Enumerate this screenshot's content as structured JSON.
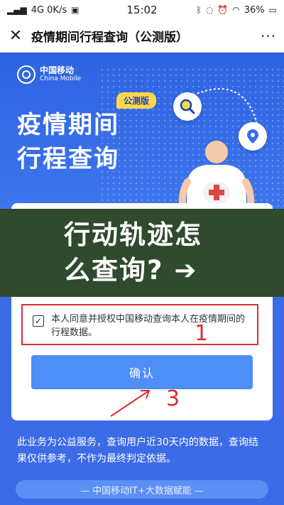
{
  "status_bar": {
    "left": "4G  0K/s",
    "signal": "all",
    "time": "15:02",
    "battery": "36%"
  },
  "nav": {
    "close_icon": "close-icon",
    "title": "疫情期间行程查询（公测版）",
    "more_icon": "more-dots-icon"
  },
  "banner": {
    "logo_cn": "中国移动",
    "logo_en": "China Mobile",
    "badge": "公测版",
    "headline_line1": "疫情期间",
    "headline_line2": "行程查询"
  },
  "overlay": {
    "line1": "行动轨迹怎",
    "line2": "么查询? ➔"
  },
  "consent": {
    "checked": true,
    "text": "本人同意并授权中国移动查询本人在疫情期间的行程数据。"
  },
  "markers": {
    "one": "1",
    "three": "3"
  },
  "confirm_label": "确认",
  "note": "此业务为公益服务，查询用户近30天内的数据，查询结果仅供参考，不作为最终判定依据。",
  "bottom_banner": "— 中国移动IT+大数据赋能 —",
  "colors": {
    "primary": "#3b6be6",
    "button": "#4d8ef7",
    "badge": "#ffd84a",
    "annotation_red": "#d9302c",
    "overlay": "#2f4a2d"
  }
}
